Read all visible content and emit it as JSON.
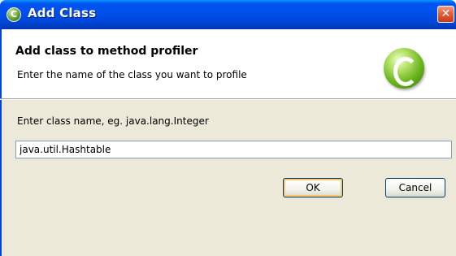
{
  "window": {
    "title": "Add Class",
    "close_glyph": "✕",
    "app_icon": "eclipse-c-icon",
    "app_icon_glyph": "C"
  },
  "header": {
    "title": "Add class to method profiler",
    "description": "Enter the name of the class you want to profile",
    "icon": "class-c-icon"
  },
  "form": {
    "prompt": "Enter class name, eg. java.lang.Integer",
    "class_name_value": "java.util.Hashtable"
  },
  "buttons": {
    "ok_label": "OK",
    "cancel_label": "Cancel"
  },
  "colors": {
    "title_bar": "#0050ee",
    "dialog_bg": "#ece9d8",
    "header_bg": "#ffffff",
    "ok_focus_ring": "#f9c86a",
    "close_button": "#e4603a"
  }
}
